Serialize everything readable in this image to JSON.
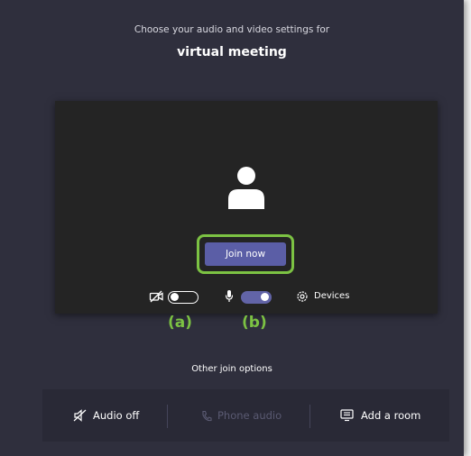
{
  "header": {
    "subtitle": "Choose your audio and video settings for",
    "meeting_name": "virtual meeting"
  },
  "preview": {
    "join_label": "Join now",
    "devices_label": "Devices",
    "camera_toggle": "off",
    "mic_toggle": "on"
  },
  "annotations": {
    "a": "(a)",
    "b": "(b)"
  },
  "other_options": {
    "heading": "Other join options",
    "items": [
      {
        "label": "Audio off",
        "icon": "speaker-off-icon",
        "enabled": true
      },
      {
        "label": "Phone audio",
        "icon": "phone-icon",
        "enabled": false
      },
      {
        "label": "Add a room",
        "icon": "room-display-icon",
        "enabled": true
      }
    ]
  },
  "colors": {
    "background": "#2f2f3d",
    "preview": "#242424",
    "accent": "#6264a7",
    "highlight": "#7cc243"
  }
}
